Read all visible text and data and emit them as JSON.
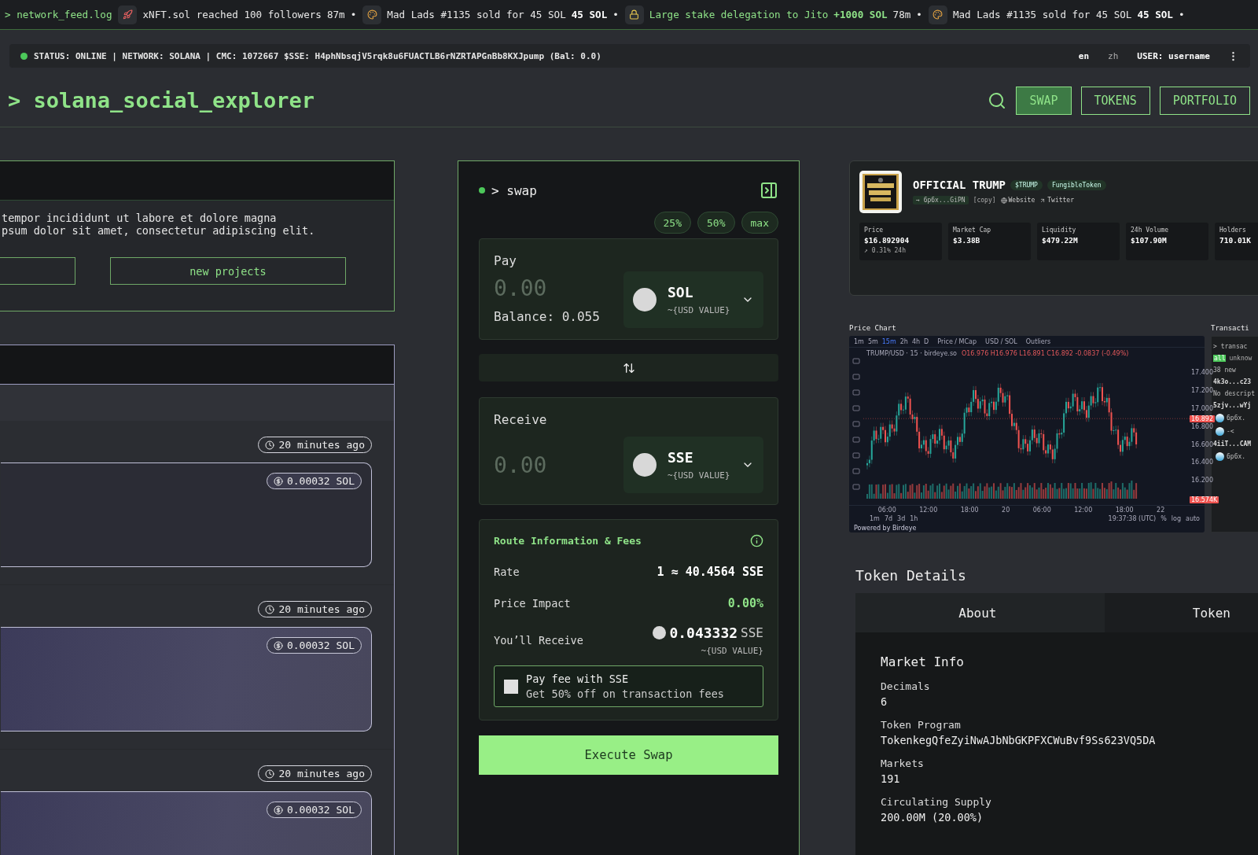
{
  "ticker": {
    "label": "> network_feed.log",
    "items": [
      {
        "kind": "follow",
        "text": "xNFT.sol reached 100 followers",
        "time": "87m",
        "bullet": "•"
      },
      {
        "kind": "sale",
        "text": "Mad Lads #1135 sold for 45 SOL",
        "amount": "45 SOL",
        "bullet": "•"
      },
      {
        "kind": "stake",
        "text": "Large stake delegation to Jito",
        "amount": "+1000 SOL",
        "time": "78m",
        "bullet": "•"
      },
      {
        "kind": "sale",
        "text": "Mad Lads #1135 sold for 45 SOL",
        "amount": "45 SOL",
        "bullet": "•"
      }
    ]
  },
  "status_bar": {
    "online": true,
    "text": "STATUS: ONLINE | NETWORK: SOLANA | CMC: 1072667  $SSE: H4phNbsqjV5rqk8u6FUACTLB6rNZRTAPGnBb8KXJpump  (Bal: 0.0)",
    "languages": [
      {
        "label": "en",
        "selected": true
      },
      {
        "label": "zh",
        "selected": false
      }
    ],
    "user": "USER: username"
  },
  "header": {
    "title": "> solana_social_explorer",
    "nav": [
      {
        "label": "SWAP",
        "selected": true
      },
      {
        "label": "TOKENS",
        "selected": false
      },
      {
        "label": "PORTFOLIO",
        "selected": false
      }
    ]
  },
  "intro_panel": {
    "lines": [
      "tempor incididunt ut labore et dolore magna",
      "psum dolor sit amet, consectetur adipiscing elit."
    ],
    "button": "new projects"
  },
  "feed": {
    "posts": [
      {
        "time": "20 minutes ago",
        "price": "0.00032 SOL",
        "highlighted": false
      },
      {
        "time": "20 minutes ago",
        "price": "0.00032 SOL",
        "highlighted": true
      },
      {
        "time": "20 minutes ago",
        "price": "0.00032 SOL",
        "highlighted": true
      }
    ]
  },
  "swap": {
    "live": true,
    "title": "> swap",
    "percents": [
      "25%",
      "50%",
      "max"
    ],
    "pay": {
      "label": "Pay",
      "placeholder": "0.00",
      "balance": "Balance: 0.055",
      "symbol": "SOL",
      "usd": "~{USD VALUE}"
    },
    "receive": {
      "label": "Receive",
      "placeholder": "0.00",
      "symbol": "SSE",
      "usd": "~{USD VALUE}"
    },
    "route": {
      "title": "Route Information & Fees",
      "rate_label": "Rate",
      "rate": "1 ≈ 40.4564 SSE",
      "impact_label": "Price Impact",
      "impact": "0.00%",
      "receive_label": "You’ll Receive",
      "receive_amount": "0.043332",
      "receive_unit": "SSE",
      "receive_usd": "~{USD VALUE}"
    },
    "fee_option": {
      "checked": false,
      "title": "Pay fee with SSE",
      "subtitle": "Get 50% off on transaction fees"
    },
    "execute": "Execute Swap"
  },
  "token_card": {
    "name": "OFFICIAL TRUMP",
    "tags": [
      "$TRUMP",
      "FungibleToken"
    ],
    "address": "→ 6p6x...GiPN",
    "copy": "[copy]",
    "links": [
      "Website",
      "Twitter"
    ],
    "stats": [
      {
        "label": "Price",
        "value": "$16.892904",
        "sub": "↗ 0.31% 24h"
      },
      {
        "label": "Market Cap",
        "value": "$3.38B"
      },
      {
        "label": "Liquidity",
        "value": "$479.22M"
      },
      {
        "label": "24h Volume",
        "value": "$107.90M"
      },
      {
        "label": "Holders",
        "value": "710.01K"
      }
    ]
  },
  "price_chart": {
    "label": "Price Chart",
    "intervals": [
      {
        "label": "1m",
        "selected": false
      },
      {
        "label": "5m",
        "selected": false
      },
      {
        "label": "15m",
        "selected": true
      },
      {
        "label": "2h",
        "selected": false
      },
      {
        "label": "4h",
        "selected": false
      },
      {
        "label": "D",
        "selected": false
      }
    ],
    "modes": [
      "Price / MCap",
      "USD / SOL",
      "Outliers"
    ],
    "symbol": "TRUMP/USD · 15 · birdeye.so",
    "ohlc": "O16.976 H16.976 L16.891 C16.892 -0.0837 (-0.49%)",
    "y_ticks": [
      "17.400",
      "17.200",
      "17.000",
      "16.800",
      "16.600",
      "16.400",
      "16.200"
    ],
    "price_tag": "16.892",
    "volume_tag": "16.574K",
    "x_ticks": [
      "06:00",
      "12:00",
      "18:00",
      "20",
      "06:00",
      "12:00",
      "18:00",
      "22"
    ],
    "ranges": [
      "1m",
      "7d",
      "3d",
      "1h"
    ],
    "clock": "19:37:38 (UTC)",
    "scale": [
      "%",
      "log",
      "auto"
    ],
    "credit": "Powered by Birdeye"
  },
  "transactions": {
    "label": "Transacti",
    "title": "> transac",
    "filters": [
      "all",
      "unknow"
    ],
    "notice": "38 new",
    "entries": [
      {
        "id": "4k3o...c23",
        "note": "No descript"
      },
      {
        "id": "5zjv...wYj",
        "who": [
          "6p6x.",
          "-<"
        ]
      },
      {
        "id": "4iiT...CAM",
        "who": [
          "6p6x."
        ]
      }
    ]
  },
  "token_details": {
    "title": "Token Details",
    "tabs": [
      {
        "label": "About",
        "selected": true
      },
      {
        "label": "Token",
        "selected": false
      }
    ],
    "section": "Market Info",
    "fields": [
      {
        "label": "Decimals",
        "value": "6"
      },
      {
        "label": "Token Program",
        "value": "TokenkegQfeZyiNwAJbNbGKPFXCWuBvf9Ss623VQ5DA"
      },
      {
        "label": "Markets",
        "value": "191"
      },
      {
        "label": "Circulating Supply",
        "value": "200.00M (20.00%)"
      }
    ]
  }
}
